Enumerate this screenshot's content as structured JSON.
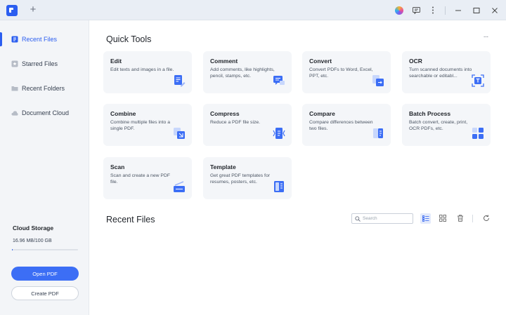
{
  "titlebar": {
    "new_tab_symbol": "+"
  },
  "sidebar": {
    "items": [
      {
        "label": "Recent Files",
        "icon": "recent-files-icon"
      },
      {
        "label": "Starred Files",
        "icon": "star-icon"
      },
      {
        "label": "Recent Folders",
        "icon": "folder-icon"
      },
      {
        "label": "Document Cloud",
        "icon": "cloud-icon"
      }
    ],
    "storage": {
      "title": "Cloud Storage",
      "amount": "16.96 MB/100 GB",
      "used_fraction": 0.0002
    },
    "open_pdf_label": "Open PDF",
    "create_pdf_label": "Create PDF"
  },
  "quick_tools": {
    "title": "Quick Tools",
    "more_symbol": "···",
    "tools": [
      {
        "title": "Edit",
        "desc": "Edit texts and images in a file.",
        "icon": "edit-icon"
      },
      {
        "title": "Comment",
        "desc": "Add comments, like highlights, pencil, stamps, etc.",
        "icon": "comment-icon"
      },
      {
        "title": "Convert",
        "desc": "Convert PDFs to Word, Excel, PPT, etc.",
        "icon": "convert-icon"
      },
      {
        "title": "OCR",
        "desc": "Turn scanned documents into searchable or editabl...",
        "icon": "ocr-icon"
      },
      {
        "title": "Combine",
        "desc": "Combine multiple files into a single PDF.",
        "icon": "combine-icon"
      },
      {
        "title": "Compress",
        "desc": "Reduce a PDF file size.",
        "icon": "compress-icon"
      },
      {
        "title": "Compare",
        "desc": "Compare differences between two files.",
        "icon": "compare-icon"
      },
      {
        "title": "Batch Process",
        "desc": "Batch convert, create, print, OCR PDFs, etc.",
        "icon": "batch-process-icon"
      },
      {
        "title": "Scan",
        "desc": "Scan and create a new PDF file.",
        "icon": "scan-icon"
      },
      {
        "title": "Template",
        "desc": "Get great PDF templates for resumes, posters, etc.",
        "icon": "template-icon"
      }
    ]
  },
  "recent_files": {
    "title": "Recent Files",
    "search_placeholder": "Search"
  },
  "colors": {
    "accent": "#2b5ef0",
    "card_bg": "#f4f6f9",
    "sidebar_bg": "#f3f5f8"
  }
}
